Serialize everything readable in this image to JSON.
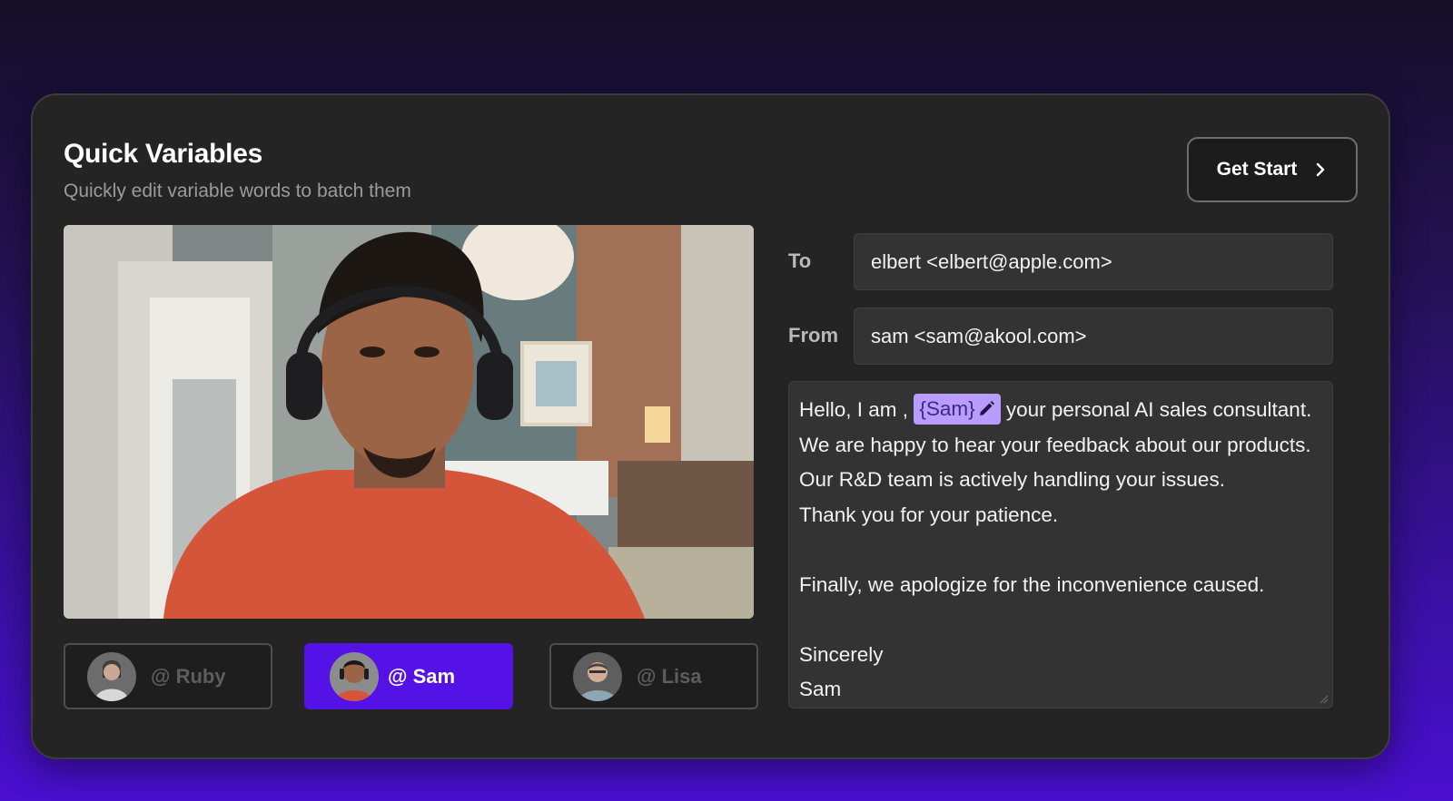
{
  "header": {
    "title": "Quick Variables",
    "subtitle": "Quickly edit variable words to batch them",
    "cta_label": "Get Start"
  },
  "avatars": [
    {
      "label": "@ Ruby",
      "active": false
    },
    {
      "label": "@ Sam",
      "active": true
    },
    {
      "label": "@ Lisa",
      "active": false
    }
  ],
  "email": {
    "to_label": "To",
    "to_value": "elbert <elbert@apple.com>",
    "from_label": "From",
    "from_value": "sam <sam@akool.com>",
    "body": {
      "line1_prefix": "Hello, I am ,",
      "variable": "{Sam}",
      "line1_suffix": "your personal AI sales consultant.",
      "line2": "We are happy to hear your feedback about our products.",
      "line3": "Our R&D team is actively handling your issues.",
      "line4": "Thank you for your patience.",
      "line5": "Finally, we apologize for the inconvenience caused.",
      "line6": "Sincerely",
      "line7": "Sam"
    }
  },
  "colors": {
    "accent": "#5512e6",
    "variable_chip": "#b99cff",
    "card_bg": "#242424"
  }
}
